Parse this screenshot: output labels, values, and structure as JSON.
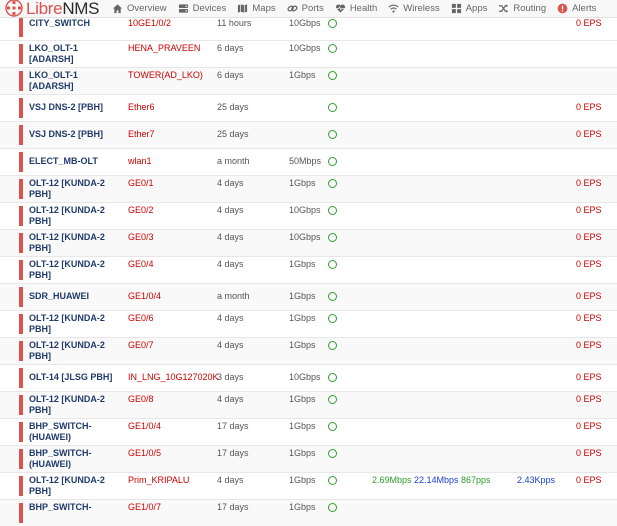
{
  "brand": {
    "name_a": "Libre",
    "name_b": "NMS"
  },
  "nav": [
    {
      "label": "Overview",
      "icon": "home-icon"
    },
    {
      "label": "Devices",
      "icon": "server-icon"
    },
    {
      "label": "Maps",
      "icon": "map-icon"
    },
    {
      "label": "Ports",
      "icon": "link-icon"
    },
    {
      "label": "Health",
      "icon": "heartbeat-icon"
    },
    {
      "label": "Wireless",
      "icon": "wifi-icon"
    },
    {
      "label": "Apps",
      "icon": "apps-grid-icon"
    },
    {
      "label": "Routing",
      "icon": "routing-icon"
    },
    {
      "label": "Alerts",
      "icon": "alert-icon"
    }
  ],
  "rows": [
    {
      "device": "CITY_SWITCH",
      "port": "10GE1/0/2",
      "uptime": "11 hours",
      "speed": "10Gbps",
      "eps": "0 EPS"
    },
    {
      "device": "LKO_OLT-1 [ADARSH]",
      "port": "HENA_PRAVEEN",
      "uptime": "6 days",
      "speed": "10Gbps",
      "eps": ""
    },
    {
      "device": "LKO_OLT-1 [ADARSH]",
      "port": "TOWER(AD_LKO)",
      "uptime": "6 days",
      "speed": "1Gbps",
      "eps": ""
    },
    {
      "device": "VSJ DNS-2 [PBH]",
      "port": "Ether6",
      "uptime": "25 days",
      "speed": "",
      "eps": "0 EPS"
    },
    {
      "device": "VSJ DNS-2 [PBH]",
      "port": "Ether7",
      "uptime": "25 days",
      "speed": "",
      "eps": "0 EPS"
    },
    {
      "device": "ELECT_MB-OLT",
      "port": "wlan1",
      "uptime": "a month",
      "speed": "50Mbps",
      "eps": ""
    },
    {
      "device": "OLT-12 [KUNDA-2 PBH]",
      "port": "GE0/1",
      "uptime": "4 days",
      "speed": "1Gbps",
      "eps": "0 EPS"
    },
    {
      "device": "OLT-12 [KUNDA-2 PBH]",
      "port": "GE0/2",
      "uptime": "4 days",
      "speed": "10Gbps",
      "eps": "0 EPS"
    },
    {
      "device": "OLT-12 [KUNDA-2 PBH]",
      "port": "GE0/3",
      "uptime": "4 days",
      "speed": "10Gbps",
      "eps": "0 EPS"
    },
    {
      "device": "OLT-12 [KUNDA-2 PBH]",
      "port": "GE0/4",
      "uptime": "4 days",
      "speed": "1Gbps",
      "eps": "0 EPS"
    },
    {
      "device": "SDR_HUAWEI",
      "port": "GE1/0/4",
      "uptime": "a month",
      "speed": "1Gbps",
      "eps": "0 EPS"
    },
    {
      "device": "OLT-12 [KUNDA-2 PBH]",
      "port": "GE0/6",
      "uptime": "4 days",
      "speed": "1Gbps",
      "eps": "0 EPS"
    },
    {
      "device": "OLT-12 [KUNDA-2 PBH]",
      "port": "GE0/7",
      "uptime": "4 days",
      "speed": "1Gbps",
      "eps": "0 EPS"
    },
    {
      "device": "OLT-14 [JLSG PBH]",
      "port": "IN_LNG_10G127020K",
      "uptime": "3 days",
      "speed": "10Gbps",
      "eps": "0 EPS"
    },
    {
      "device": "OLT-12 [KUNDA-2 PBH]",
      "port": "GE0/8",
      "uptime": "4 days",
      "speed": "1Gbps",
      "eps": "0 EPS"
    },
    {
      "device": "BHP_SWITCH-(HUAWEI)",
      "port": "GE1/0/4",
      "uptime": "17 days",
      "speed": "1Gbps",
      "eps": "0 EPS"
    },
    {
      "device": "BHP_SWITCH-(HUAWEI)",
      "port": "GE1/0/5",
      "uptime": "17 days",
      "speed": "1Gbps",
      "eps": "0 EPS"
    },
    {
      "device": "OLT-12 [KUNDA-2 PBH]",
      "port": "Prim_KRIPALU",
      "uptime": "4 days",
      "speed": "1Gbps",
      "in_rate": "2.69Mbps",
      "out_rate": "22.14Mbps",
      "in_pps": "867pps",
      "out_pps": "2.43Kpps",
      "eps": "0 EPS"
    },
    {
      "device": "BHP_SWITCH-",
      "port": "GE1/0/7",
      "uptime": "17 days",
      "speed": "1Gbps",
      "eps": ""
    }
  ],
  "colors": {
    "accent": "#d9534f",
    "device": "#1f3a6b",
    "port": "#cc0000",
    "status_ok": "#2ea02e",
    "in": "#2a9d2a",
    "out": "#1a3fd1"
  }
}
